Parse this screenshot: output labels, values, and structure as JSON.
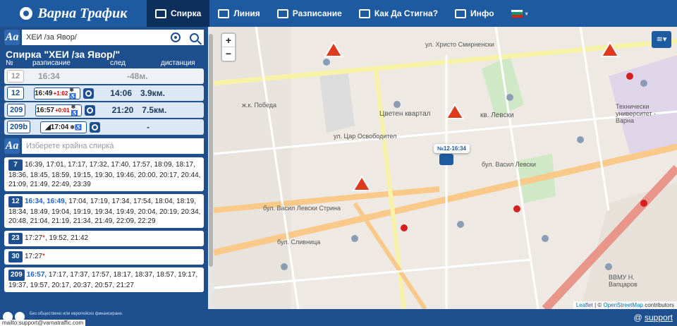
{
  "header": {
    "logo": "Варна Трафик",
    "nav": [
      {
        "label": "Спирка",
        "icon": "bus-stop-icon",
        "active": true
      },
      {
        "label": "Линия",
        "icon": "bus-icon"
      },
      {
        "label": "Разписание",
        "icon": "calendar-icon"
      },
      {
        "label": "Как Да Стигна?",
        "icon": "route-icon"
      },
      {
        "label": "Инфо",
        "icon": "info-icon"
      }
    ],
    "flag_colors": [
      "#ffffff",
      "#00966e",
      "#d62612"
    ]
  },
  "search": {
    "aa": "Aa",
    "value": "ХЕИ /за Явор/"
  },
  "stop": {
    "title": "Спирка \"ХЕИ /за Явор/\"",
    "columns": [
      "№",
      "разписание",
      "след",
      "дистанция"
    ],
    "rows": [
      {
        "line": "12",
        "time": "16:34",
        "next": "",
        "distance": "-48м.",
        "dim": true
      },
      {
        "line": "12",
        "time": "16:49",
        "delay": "+1:02",
        "flags": "❄♿",
        "next": "14:06",
        "distance": "3.9км."
      },
      {
        "line": "209",
        "time": "16:57",
        "delay": "+0:01",
        "flags": "❄♿",
        "next": "21:20",
        "distance": "7.5км."
      },
      {
        "line": "209b",
        "time": "◢17:04",
        "delay": "",
        "flags": "❄♿",
        "next": "",
        "distance": "-"
      }
    ]
  },
  "end_stop": {
    "aa": "Aa",
    "placeholder": "Изберете крайна спирка"
  },
  "lines": [
    {
      "line": "7",
      "hl": "",
      "rest": "16:39, 17:01, 17:17, 17:32, 17:40, 17:57, 18:09, 18:17, 18:36, 18:45, 18:59, 19:15, 19:30, 19:46, 20:00, 20:17, 20:44, 21:09, 21:49, 22:49, 23:39",
      "star": ""
    },
    {
      "line": "12",
      "hl": "16:34, 16:49,",
      "rest": " 17:04, 17:19, 17:34, 17:54, 18:04, 18:19, 18:34, 18:49, 19:04, 19:19, 19:34, 19:49, 20:04, 20:19, 20:34, 20:48, 21:04, 21:19, 21:34, 21:49, 22:09, 22:29",
      "star": ""
    },
    {
      "line": "23",
      "hl": "",
      "rest": "17:27",
      "star": "*",
      "tail": ", 19:52, 21:42"
    },
    {
      "line": "30",
      "hl": "",
      "rest": "17:27",
      "star": "*",
      "tail": ""
    },
    {
      "line": "209",
      "hl": "16:57,",
      "rest": " 17:17, 17:37, 17:57, 18:17, 18:37, 18:57, 19:17, 19:37, 19:57, 20:17, 20:37, 20:57, 21:27",
      "star": ""
    }
  ],
  "map": {
    "zoom_in": "+",
    "zoom_out": "−",
    "layers": "≋▾",
    "bus_label": "№12-16:34",
    "labels": [
      "ул. Христо Смирненски",
      "ж.к. Победа",
      "Цветен квартал",
      "кв. Левски",
      "бул. Васил Левски",
      "бул. Васил Левски Стрина",
      "ул. Цар Освободител",
      "Технически университет - Варна",
      "ВВМУ Н. Вапцаров",
      "бул. Сливница"
    ],
    "attribution_a": "Leaflet",
    "attribution_b": " | © ",
    "attribution_c": "OpenStreetMap",
    "attribution_d": " contributors"
  },
  "footer": {
    "eu": "Без обществено или европейско финансиране.",
    "mail": "mailto:support@varnatraffic.com",
    "support_prefix": "@ ",
    "support": "support"
  }
}
